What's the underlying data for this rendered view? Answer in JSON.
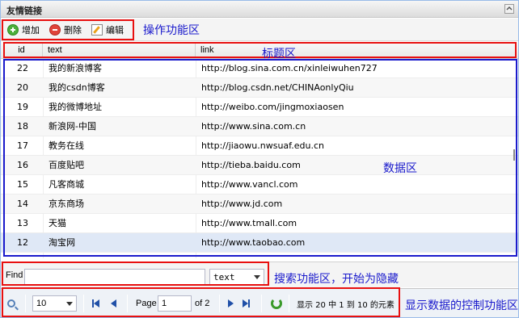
{
  "panel": {
    "title": "友情链接"
  },
  "toolbar": {
    "add_label": "增加",
    "delete_label": "删除",
    "edit_label": "编辑"
  },
  "annotations": {
    "toolbar": "操作功能区",
    "header": "标题区",
    "data": "数据区",
    "search": "搜索功能区，开始为隐藏",
    "pager": "显示数据的控制功能区"
  },
  "grid": {
    "columns": [
      "id",
      "text",
      "link"
    ],
    "rows": [
      {
        "id": "22",
        "text": "我的新浪博客",
        "link": "http://blog.sina.com.cn/xinleiwuhen727"
      },
      {
        "id": "20",
        "text": "我的csdn博客",
        "link": "http://blog.csdn.net/CHINAonlyQiu"
      },
      {
        "id": "19",
        "text": "我的微博地址",
        "link": "http://weibo.com/jingmoxiaosen"
      },
      {
        "id": "18",
        "text": "新浪网-中国",
        "link": "http://www.sina.com.cn"
      },
      {
        "id": "17",
        "text": "教务在线",
        "link": "http://jiaowu.nwsuaf.edu.cn"
      },
      {
        "id": "16",
        "text": "百度贴吧",
        "link": "http://tieba.baidu.com"
      },
      {
        "id": "15",
        "text": "凡客商城",
        "link": "http://www.vancl.com"
      },
      {
        "id": "14",
        "text": "京东商场",
        "link": "http://www.jd.com"
      },
      {
        "id": "13",
        "text": "天猫",
        "link": "http://www.tmall.com"
      },
      {
        "id": "12",
        "text": "淘宝网",
        "link": "http://www.taobao.com"
      }
    ],
    "selected_row": 9
  },
  "find": {
    "label": "Find",
    "value": "",
    "field_selected": "text"
  },
  "pager": {
    "page_size": "10",
    "page_label": "Page",
    "page_value": "1",
    "of_label": "of 2",
    "summary": "显示 20 中 1 到 10 的元素"
  },
  "icons": {
    "add": "add-icon",
    "delete": "delete-icon",
    "edit": "edit-icon",
    "collapse": "collapse-icon",
    "search": "search-icon",
    "first": "first-page-icon",
    "prev": "prev-page-icon",
    "next": "next-page-icon",
    "last": "last-page-icon",
    "refresh": "refresh-icon"
  },
  "colors": {
    "annotation_red": "#e81010",
    "annotation_blue": "#1a1acc",
    "selected_row": "#dfe8f6"
  }
}
